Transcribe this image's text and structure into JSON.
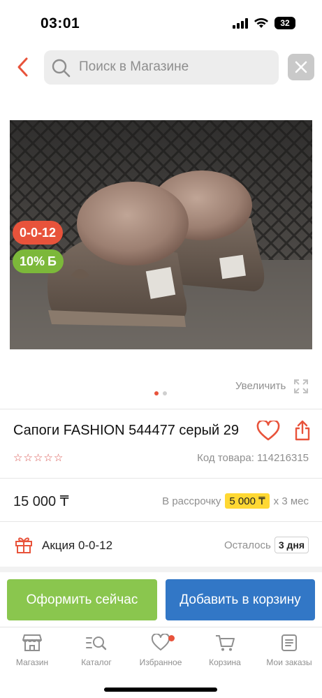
{
  "status_bar": {
    "time": "03:01",
    "battery": "32",
    "icons": [
      "cellular-signal-icon",
      "wifi-icon",
      "battery-icon"
    ]
  },
  "search": {
    "placeholder": "Поиск в Магазине",
    "icons": [
      "back-icon",
      "search-icon",
      "close-icon"
    ]
  },
  "gallery": {
    "promo_badge": "0-0-12",
    "cashback_badge": "10%",
    "cashback_symbol": "Б",
    "zoom_label": "Увеличить",
    "page_count": 2,
    "active_page": 1,
    "icons": [
      "expand-icon"
    ]
  },
  "product": {
    "title": "Сапоги FASHION 544477 серый 29",
    "rating_stars": 0,
    "rating_max": 5,
    "sku_label": "Код товара: 114216315",
    "icons": [
      "heart-icon",
      "share-icon",
      "star-outline-icon"
    ]
  },
  "pricing": {
    "price": "15 000 ₸",
    "installment_prefix": "В рассрочку",
    "installment_amount": "5 000 ₸",
    "installment_suffix": "х 3 мес"
  },
  "promo": {
    "title": "Акция 0-0-12",
    "remaining_label": "Осталось",
    "remaining_value": "3 дня",
    "icons": [
      "gift-icon"
    ]
  },
  "actions": {
    "checkout": "Оформить сейчас",
    "add_to_cart": "Добавить в корзину"
  },
  "bottom_nav": {
    "items": [
      {
        "label": "Магазин",
        "icon": "shop-icon"
      },
      {
        "label": "Каталог",
        "icon": "catalog-search-icon"
      },
      {
        "label": "Избранное",
        "icon": "heart-icon"
      },
      {
        "label": "Корзина",
        "icon": "cart-icon"
      },
      {
        "label": "Мои заказы",
        "icon": "orders-icon"
      }
    ]
  },
  "colors": {
    "accent_red": "#e8533b",
    "green": "#8ac64e",
    "blue": "#3277c6",
    "installment_highlight": "#ffd833",
    "cashback_green": "#7cb83a"
  }
}
